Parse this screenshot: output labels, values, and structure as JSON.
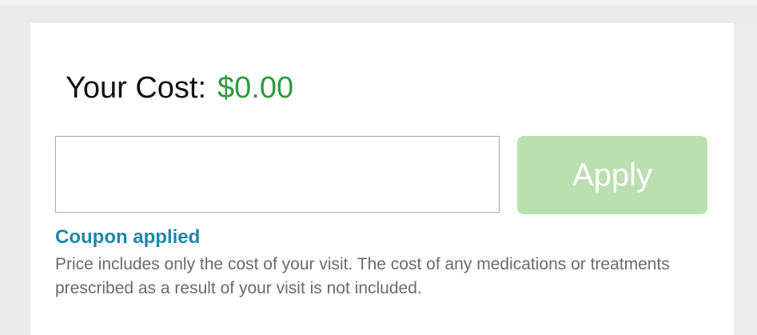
{
  "cost": {
    "label": "Your Cost:",
    "value": "$0.00"
  },
  "coupon": {
    "input_value": "",
    "input_placeholder": "",
    "apply_label": "Apply",
    "status": "Coupon applied"
  },
  "disclaimer": "Price includes only the cost of your visit. The cost of any medications or treatments prescribed as a result of your visit is not included.",
  "colors": {
    "cost_value": "#2e9a3e",
    "apply_button": "#bcdfb1",
    "coupon_status": "#1f86a8"
  }
}
